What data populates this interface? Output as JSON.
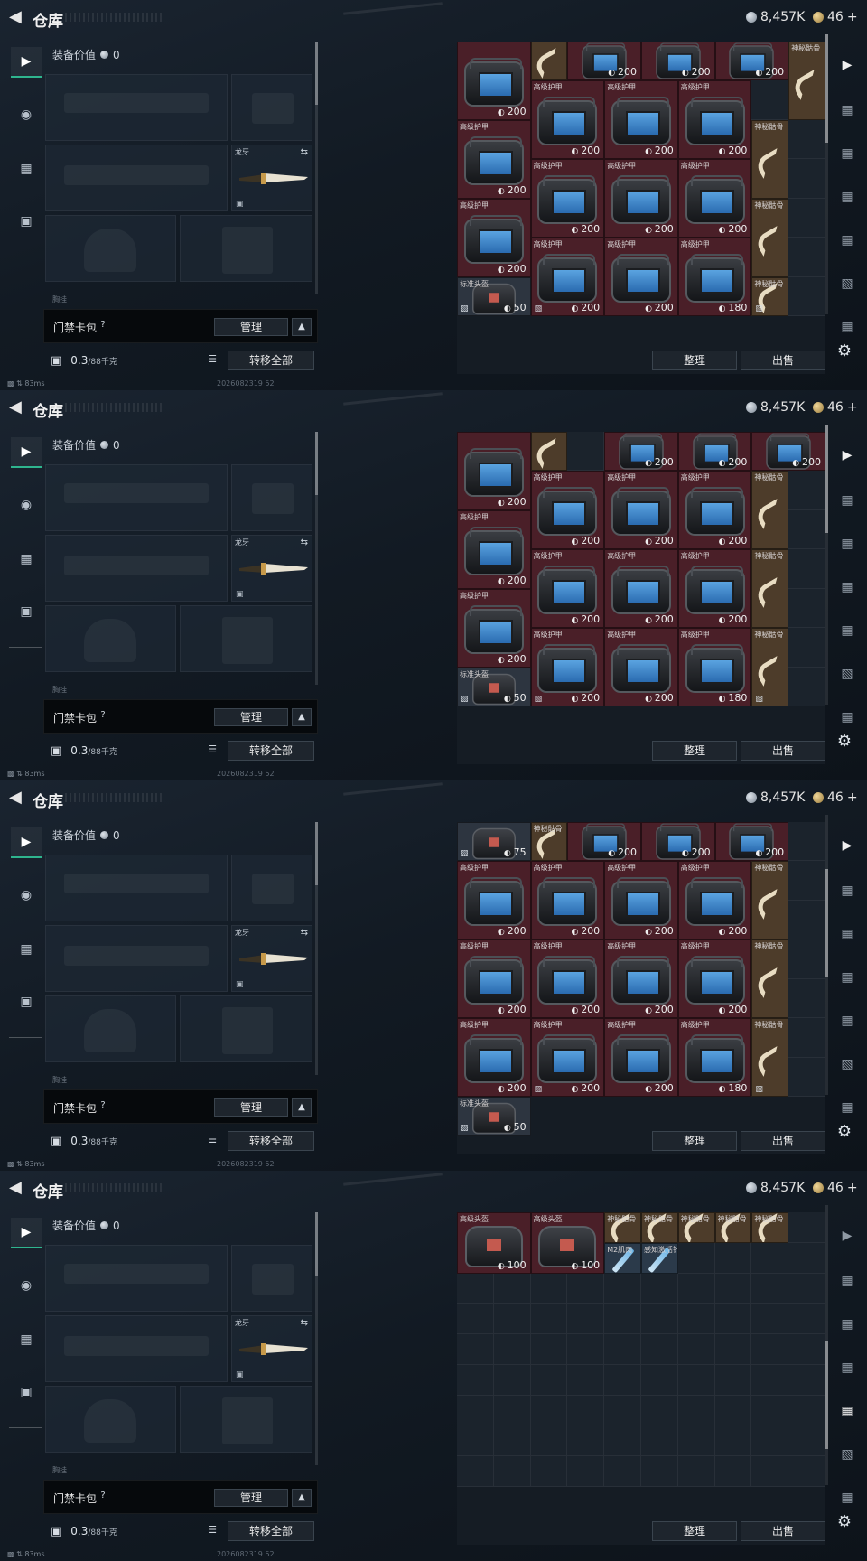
{
  "header": {
    "title": "仓库",
    "silver_amount": "8,457K",
    "gold_amount": "46",
    "gold_plus": "+"
  },
  "left_nav": [
    "gun-icon",
    "helmet-icon",
    "vest-icon",
    "briefcase-icon"
  ],
  "equipment": {
    "value_label": "装备价值",
    "value": "0",
    "melee_slot_label": "龙牙",
    "partial_label": "胸挂"
  },
  "cardbag": {
    "label": "门禁卡包",
    "help": "?",
    "manage_label": "管理"
  },
  "footer": {
    "weight_value": "0.3",
    "weight_unit": "/88千克",
    "transfer_all": "转移全部",
    "ping": "83ms",
    "timestamp": "2026082319 52"
  },
  "stash_actions": {
    "sort_label": "整理",
    "sell_label": "出售"
  },
  "item_names": {
    "armor": "高级护甲",
    "bone": "神秘骷骨",
    "std_helmet": "标准头盔",
    "adv_helmet": "高级头盔",
    "m2": "M2肌肉",
    "injector": "感知激活针"
  },
  "frames": [
    {
      "items": [
        {
          "c": 0,
          "r": 0,
          "w": 2,
          "h": 2,
          "kind": "armor",
          "color": "red",
          "label": "",
          "dur": "200"
        },
        {
          "c": 2,
          "r": 0,
          "w": 1,
          "h": 1,
          "kind": "bone",
          "color": "brown",
          "label": "",
          "dur": ""
        },
        {
          "c": 3,
          "r": 0,
          "w": 2,
          "h": 1,
          "kind": "armor",
          "color": "red",
          "label": "",
          "dur": "200",
          "shift": true
        },
        {
          "c": 5,
          "r": 0,
          "w": 2,
          "h": 1,
          "kind": "armor",
          "color": "red",
          "label": "",
          "dur": "200",
          "shift": true
        },
        {
          "c": 7,
          "r": 0,
          "w": 2,
          "h": 1,
          "kind": "armor",
          "color": "red",
          "label": "",
          "dur": "200",
          "shift": true
        },
        {
          "c": 9,
          "r": 0,
          "w": 1,
          "h": 2,
          "kind": "bone",
          "color": "brown",
          "label": "神秘骷骨",
          "dur": ""
        },
        {
          "c": 0,
          "r": 2,
          "w": 2,
          "h": 2,
          "kind": "armor",
          "color": "red",
          "label": "高级护甲",
          "dur": "200"
        },
        {
          "c": 2,
          "r": 1,
          "w": 2,
          "h": 2,
          "kind": "armor",
          "color": "red",
          "label": "高级护甲",
          "dur": "200"
        },
        {
          "c": 4,
          "r": 1,
          "w": 2,
          "h": 2,
          "kind": "armor",
          "color": "red",
          "label": "高级护甲",
          "dur": "200"
        },
        {
          "c": 6,
          "r": 1,
          "w": 2,
          "h": 2,
          "kind": "armor",
          "color": "red",
          "label": "高级护甲",
          "dur": "200"
        },
        {
          "c": 8,
          "r": 2,
          "w": 1,
          "h": 2,
          "kind": "bone",
          "color": "brown",
          "label": "神秘骷骨",
          "dur": ""
        },
        {
          "c": 0,
          "r": 4,
          "w": 2,
          "h": 2,
          "kind": "armor",
          "color": "red",
          "label": "高级护甲",
          "dur": "200"
        },
        {
          "c": 2,
          "r": 3,
          "w": 2,
          "h": 2,
          "kind": "armor",
          "color": "red",
          "label": "高级护甲",
          "dur": "200"
        },
        {
          "c": 4,
          "r": 3,
          "w": 2,
          "h": 2,
          "kind": "armor",
          "color": "red",
          "label": "高级护甲",
          "dur": "200"
        },
        {
          "c": 6,
          "r": 3,
          "w": 2,
          "h": 2,
          "kind": "armor",
          "color": "red",
          "label": "高级护甲",
          "dur": "200"
        },
        {
          "c": 8,
          "r": 4,
          "w": 1,
          "h": 2,
          "kind": "bone",
          "color": "brown",
          "label": "神秘骷骨",
          "dur": ""
        },
        {
          "c": 0,
          "r": 6,
          "w": 2,
          "h": 1,
          "kind": "helmet",
          "color": "gray",
          "label": "标准头盔",
          "dur": "50",
          "flag": true
        },
        {
          "c": 2,
          "r": 5,
          "w": 2,
          "h": 2,
          "kind": "armor",
          "color": "red",
          "label": "高级护甲",
          "dur": "200",
          "flag": true
        },
        {
          "c": 4,
          "r": 5,
          "w": 2,
          "h": 2,
          "kind": "armor",
          "color": "red",
          "label": "高级护甲",
          "dur": "200"
        },
        {
          "c": 6,
          "r": 5,
          "w": 2,
          "h": 2,
          "kind": "armor",
          "color": "red",
          "label": "高级护甲",
          "dur": "180"
        },
        {
          "c": 8,
          "r": 6,
          "w": 1,
          "h": 1,
          "kind": "bone",
          "color": "brown",
          "label": "神秘骷骨",
          "dur": "",
          "flag": true
        }
      ],
      "empty_rows": 0
    },
    {
      "items": [
        {
          "c": 0,
          "r": 0,
          "w": 2,
          "h": 2,
          "kind": "armor",
          "color": "red",
          "label": "",
          "dur": "200"
        },
        {
          "c": 2,
          "r": 0,
          "w": 1,
          "h": 1,
          "kind": "bone",
          "color": "brown",
          "label": "",
          "dur": ""
        },
        {
          "c": 4,
          "r": 0,
          "w": 2,
          "h": 1,
          "kind": "armor",
          "color": "red",
          "label": "",
          "dur": "200",
          "shift": true
        },
        {
          "c": 6,
          "r": 0,
          "w": 2,
          "h": 1,
          "kind": "armor",
          "color": "red",
          "label": "",
          "dur": "200",
          "shift": true
        },
        {
          "c": 8,
          "r": 0,
          "w": 2,
          "h": 1,
          "kind": "armor",
          "color": "red",
          "label": "",
          "dur": "200",
          "shift": true
        },
        {
          "c": 2,
          "r": 1,
          "w": 2,
          "h": 2,
          "kind": "armor",
          "color": "red",
          "label": "高级护甲",
          "dur": "200"
        },
        {
          "c": 4,
          "r": 1,
          "w": 2,
          "h": 2,
          "kind": "armor",
          "color": "red",
          "label": "高级护甲",
          "dur": "200"
        },
        {
          "c": 6,
          "r": 1,
          "w": 2,
          "h": 2,
          "kind": "armor",
          "color": "red",
          "label": "高级护甲",
          "dur": "200"
        },
        {
          "c": 8,
          "r": 1,
          "w": 1,
          "h": 2,
          "kind": "bone",
          "color": "brown",
          "label": "神秘骷骨",
          "dur": ""
        },
        {
          "c": 0,
          "r": 2,
          "w": 2,
          "h": 2,
          "kind": "armor",
          "color": "red",
          "label": "高级护甲",
          "dur": "200"
        },
        {
          "c": 2,
          "r": 3,
          "w": 2,
          "h": 2,
          "kind": "armor",
          "color": "red",
          "label": "高级护甲",
          "dur": "200"
        },
        {
          "c": 4,
          "r": 3,
          "w": 2,
          "h": 2,
          "kind": "armor",
          "color": "red",
          "label": "高级护甲",
          "dur": "200"
        },
        {
          "c": 6,
          "r": 3,
          "w": 2,
          "h": 2,
          "kind": "armor",
          "color": "red",
          "label": "高级护甲",
          "dur": "200"
        },
        {
          "c": 8,
          "r": 3,
          "w": 1,
          "h": 2,
          "kind": "bone",
          "color": "brown",
          "label": "神秘骷骨",
          "dur": ""
        },
        {
          "c": 0,
          "r": 4,
          "w": 2,
          "h": 2,
          "kind": "armor",
          "color": "red",
          "label": "高级护甲",
          "dur": "200"
        },
        {
          "c": 0,
          "r": 6,
          "w": 2,
          "h": 1,
          "kind": "helmet",
          "color": "gray",
          "label": "标准头盔",
          "dur": "50",
          "flag": true
        },
        {
          "c": 2,
          "r": 5,
          "w": 2,
          "h": 2,
          "kind": "armor",
          "color": "red",
          "label": "高级护甲",
          "dur": "200",
          "flag": true
        },
        {
          "c": 4,
          "r": 5,
          "w": 2,
          "h": 2,
          "kind": "armor",
          "color": "red",
          "label": "高级护甲",
          "dur": "200"
        },
        {
          "c": 6,
          "r": 5,
          "w": 2,
          "h": 2,
          "kind": "armor",
          "color": "red",
          "label": "高级护甲",
          "dur": "180"
        },
        {
          "c": 8,
          "r": 5,
          "w": 1,
          "h": 2,
          "kind": "bone",
          "color": "brown",
          "label": "神秘骷骨",
          "dur": "",
          "flag": true
        }
      ],
      "empty_rows": 0
    },
    {
      "items": [
        {
          "c": 0,
          "r": 0,
          "w": 2,
          "h": 1,
          "kind": "helmet",
          "color": "gray",
          "label": "",
          "dur": "75",
          "flag": true
        },
        {
          "c": 2,
          "r": 0,
          "w": 1,
          "h": 1,
          "kind": "bone",
          "color": "brown",
          "label": "神秘骷骨",
          "dur": ""
        },
        {
          "c": 3,
          "r": 0,
          "w": 2,
          "h": 1,
          "kind": "armor",
          "color": "red",
          "label": "",
          "dur": "200"
        },
        {
          "c": 5,
          "r": 0,
          "w": 2,
          "h": 1,
          "kind": "armor",
          "color": "red",
          "label": "",
          "dur": "200"
        },
        {
          "c": 7,
          "r": 0,
          "w": 2,
          "h": 1,
          "kind": "armor",
          "color": "red",
          "label": "",
          "dur": "200"
        },
        {
          "c": 0,
          "r": 1,
          "w": 2,
          "h": 2,
          "kind": "armor",
          "color": "red",
          "label": "高级护甲",
          "dur": "200"
        },
        {
          "c": 2,
          "r": 1,
          "w": 2,
          "h": 2,
          "kind": "armor",
          "color": "red",
          "label": "高级护甲",
          "dur": "200"
        },
        {
          "c": 4,
          "r": 1,
          "w": 2,
          "h": 2,
          "kind": "armor",
          "color": "red",
          "label": "高级护甲",
          "dur": "200"
        },
        {
          "c": 6,
          "r": 1,
          "w": 2,
          "h": 2,
          "kind": "armor",
          "color": "red",
          "label": "高级护甲",
          "dur": "200"
        },
        {
          "c": 8,
          "r": 1,
          "w": 1,
          "h": 2,
          "kind": "bone",
          "color": "brown",
          "label": "神秘骷骨",
          "dur": ""
        },
        {
          "c": 0,
          "r": 3,
          "w": 2,
          "h": 2,
          "kind": "armor",
          "color": "red",
          "label": "高级护甲",
          "dur": "200"
        },
        {
          "c": 2,
          "r": 3,
          "w": 2,
          "h": 2,
          "kind": "armor",
          "color": "red",
          "label": "高级护甲",
          "dur": "200"
        },
        {
          "c": 4,
          "r": 3,
          "w": 2,
          "h": 2,
          "kind": "armor",
          "color": "red",
          "label": "高级护甲",
          "dur": "200"
        },
        {
          "c": 6,
          "r": 3,
          "w": 2,
          "h": 2,
          "kind": "armor",
          "color": "red",
          "label": "高级护甲",
          "dur": "200"
        },
        {
          "c": 8,
          "r": 3,
          "w": 1,
          "h": 2,
          "kind": "bone",
          "color": "brown",
          "label": "神秘骷骨",
          "dur": ""
        },
        {
          "c": 0,
          "r": 5,
          "w": 2,
          "h": 2,
          "kind": "armor",
          "color": "red",
          "label": "高级护甲",
          "dur": "200"
        },
        {
          "c": 0,
          "r": 7,
          "w": 2,
          "h": 1,
          "kind": "helmet",
          "color": "gray",
          "label": "标准头盔",
          "dur": "50",
          "flag": true
        },
        {
          "c": 2,
          "r": 5,
          "w": 2,
          "h": 2,
          "kind": "armor",
          "color": "red",
          "label": "高级护甲",
          "dur": "200",
          "flag": true
        },
        {
          "c": 4,
          "r": 5,
          "w": 2,
          "h": 2,
          "kind": "armor",
          "color": "red",
          "label": "高级护甲",
          "dur": "200"
        },
        {
          "c": 6,
          "r": 5,
          "w": 2,
          "h": 2,
          "kind": "armor",
          "color": "red",
          "label": "高级护甲",
          "dur": "180"
        },
        {
          "c": 8,
          "r": 5,
          "w": 1,
          "h": 2,
          "kind": "bone",
          "color": "brown",
          "label": "神秘骷骨",
          "dur": "",
          "flag": true
        }
      ],
      "empty_rows": 0
    },
    {
      "items": [
        {
          "c": 0,
          "r": 0,
          "w": 2,
          "h": 2,
          "kind": "helmet",
          "color": "red",
          "label": "高级头盔",
          "dur": "100"
        },
        {
          "c": 2,
          "r": 0,
          "w": 2,
          "h": 2,
          "kind": "helmet",
          "color": "red",
          "label": "高级头盔",
          "dur": "100"
        },
        {
          "c": 4,
          "r": 0,
          "w": 1,
          "h": 1,
          "kind": "bone",
          "color": "brown",
          "label": "神秘骷骨",
          "dur": ""
        },
        {
          "c": 5,
          "r": 0,
          "w": 1,
          "h": 1,
          "kind": "bone",
          "color": "brown",
          "label": "神秘骷骨",
          "dur": ""
        },
        {
          "c": 6,
          "r": 0,
          "w": 1,
          "h": 1,
          "kind": "bone",
          "color": "brown",
          "label": "神秘骷骨",
          "dur": ""
        },
        {
          "c": 7,
          "r": 0,
          "w": 1,
          "h": 1,
          "kind": "bone",
          "color": "brown",
          "label": "神秘骷骨",
          "dur": ""
        },
        {
          "c": 8,
          "r": 0,
          "w": 1,
          "h": 1,
          "kind": "bone",
          "color": "brown",
          "label": "神秘骷骨",
          "dur": ""
        },
        {
          "c": 4,
          "r": 1,
          "w": 1,
          "h": 1,
          "kind": "syringe",
          "color": "blue",
          "label": "M2肌肉",
          "dur": ""
        },
        {
          "c": 5,
          "r": 1,
          "w": 1,
          "h": 1,
          "kind": "syringe",
          "color": "blue",
          "label": "感知激活针",
          "dur": ""
        }
      ],
      "empty_rows": 2
    }
  ]
}
